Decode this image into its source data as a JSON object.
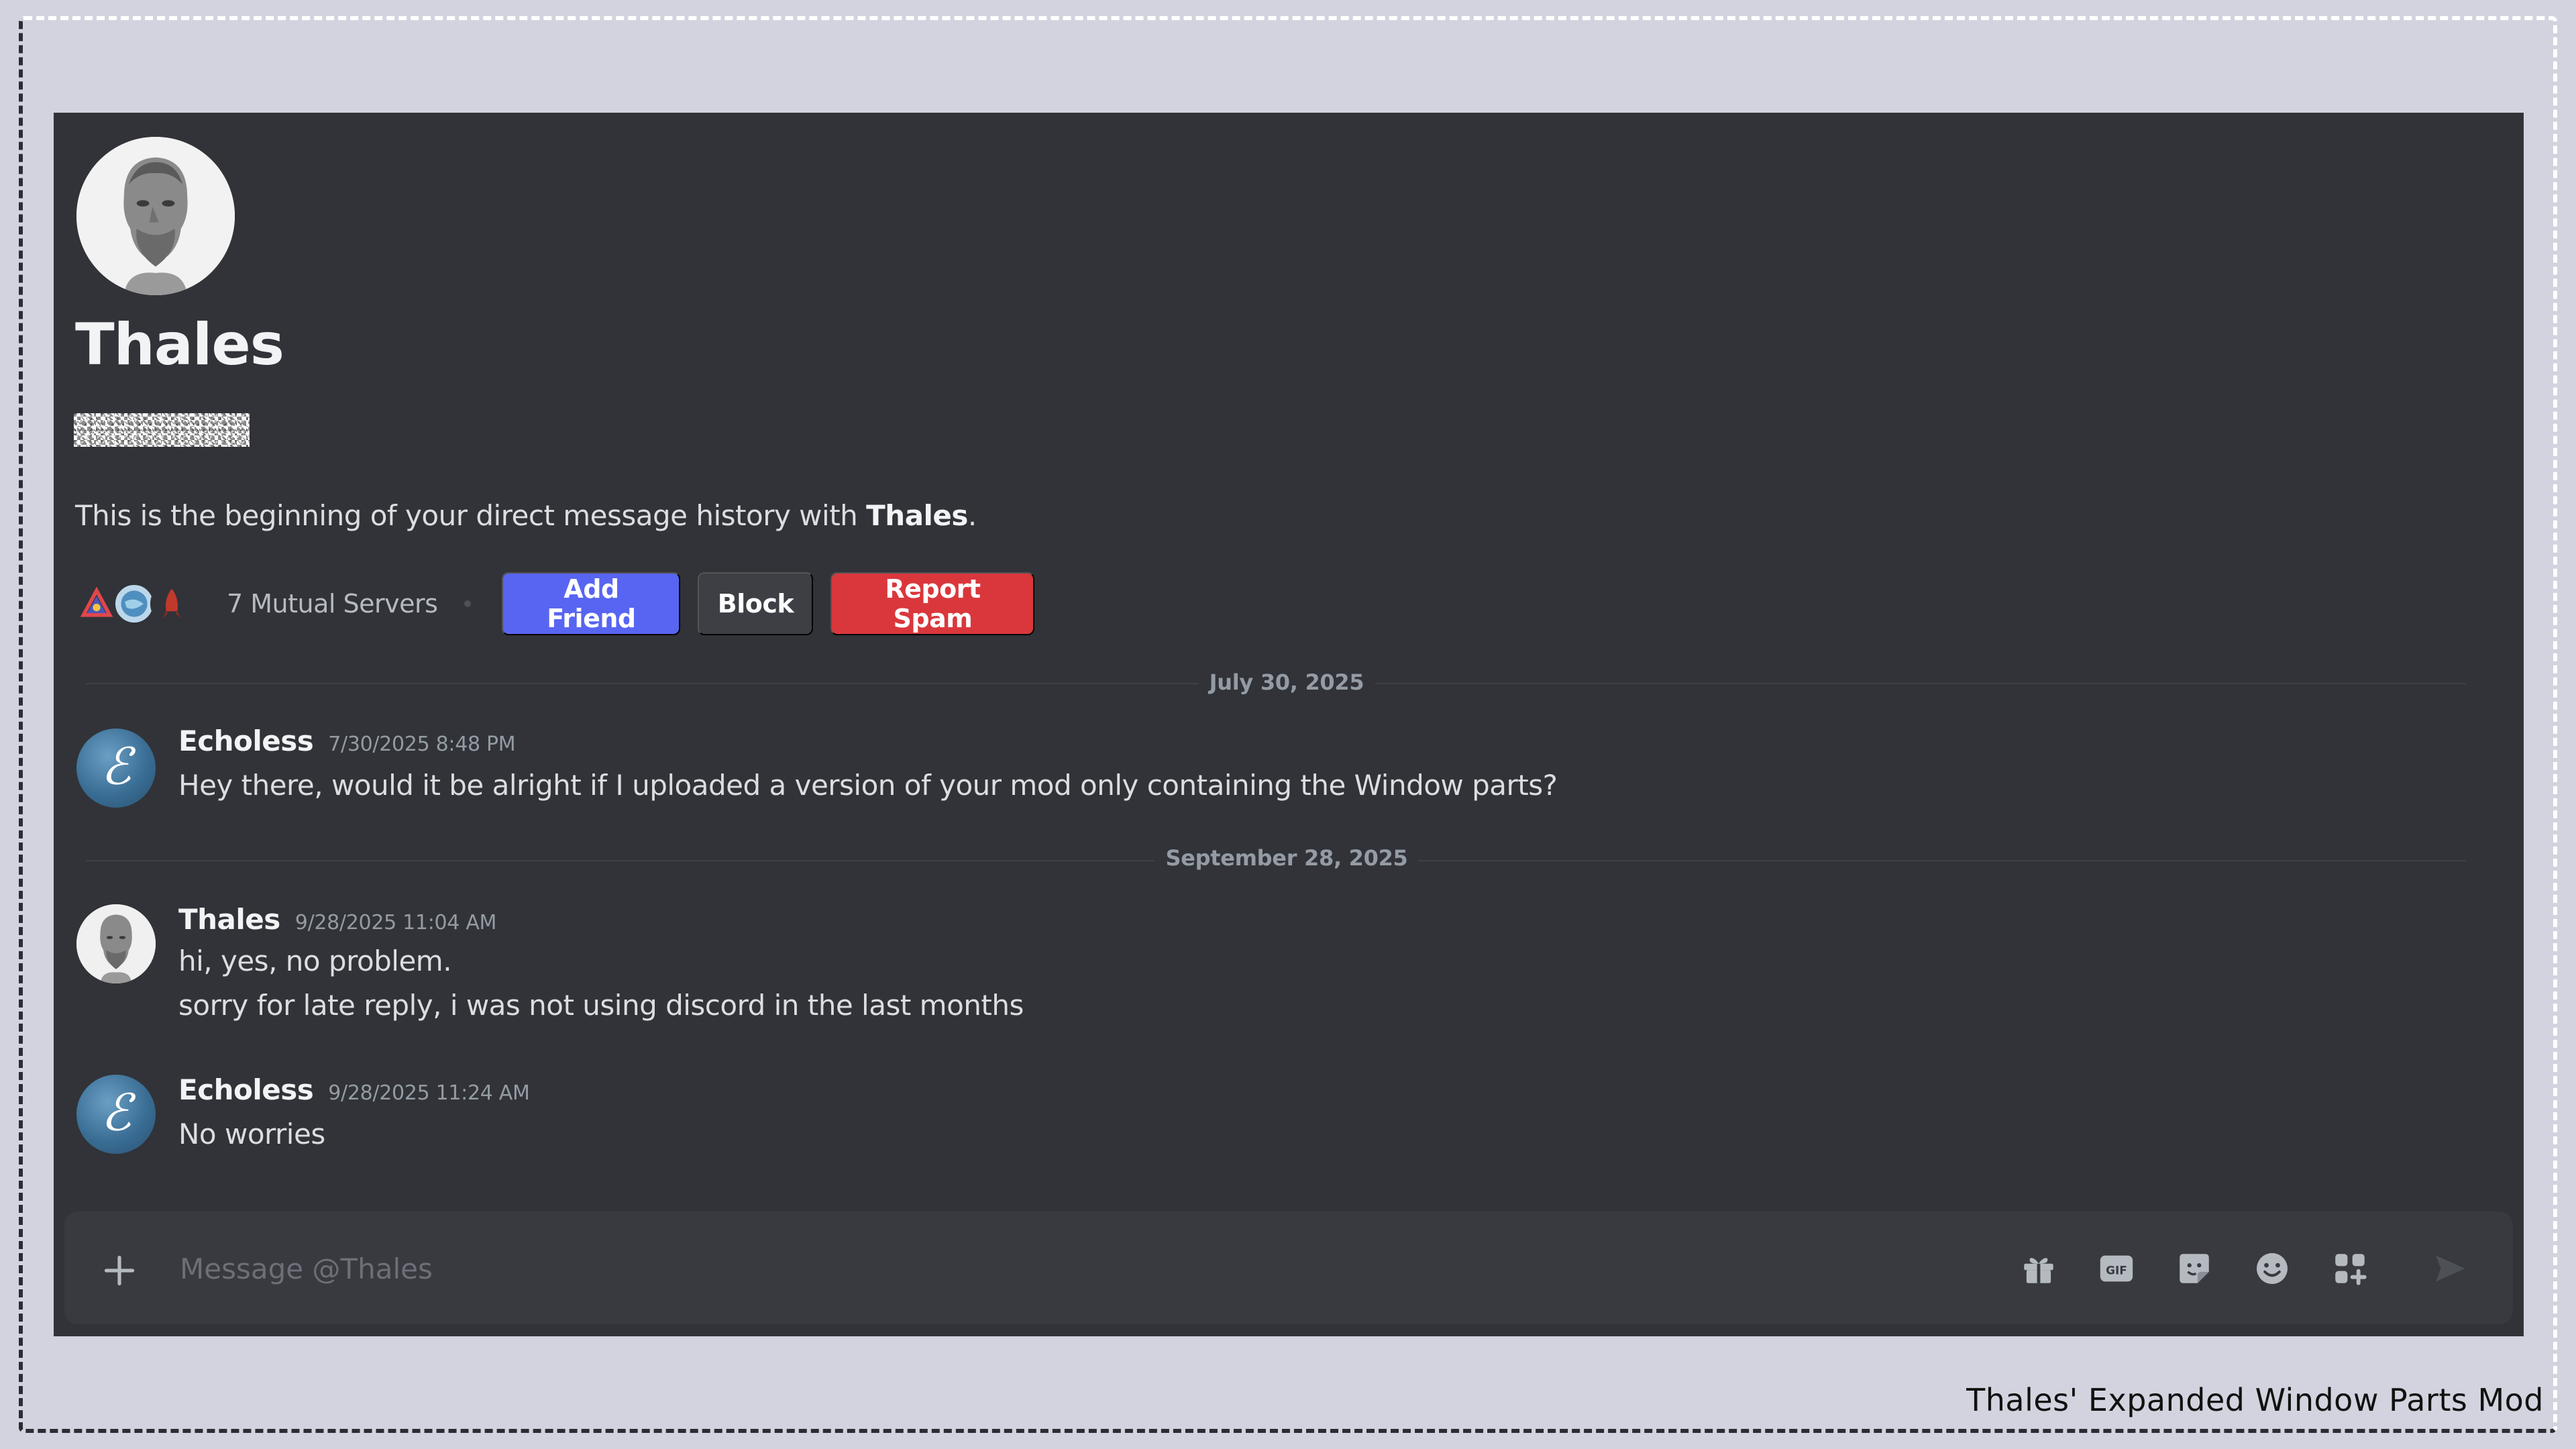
{
  "profile": {
    "name": "Thales",
    "intro_prefix": "This is the beginning of your direct message history with ",
    "intro_name": "Thales",
    "intro_suffix": "."
  },
  "actions": {
    "mutual_servers": "7 Mutual Servers",
    "add_friend": "Add Friend",
    "block": "Block",
    "report_spam": "Report Spam"
  },
  "dividers": [
    {
      "label": "July 30, 2025"
    },
    {
      "label": "September 28, 2025"
    }
  ],
  "messages": [
    {
      "author": "Echoless",
      "timestamp": "7/30/2025 8:48 PM",
      "lines": [
        "Hey there, would it be alright if I uploaded a version of your mod only containing the Window parts?"
      ]
    },
    {
      "author": "Thales",
      "timestamp": "9/28/2025 11:04 AM",
      "lines": [
        "hi, yes, no problem.",
        "sorry for late reply, i was not using discord in the last months"
      ]
    },
    {
      "author": "Echoless",
      "timestamp": "9/28/2025 11:24 AM",
      "lines": [
        "No worries"
      ]
    }
  ],
  "composer": {
    "placeholder": "Message @Thales",
    "icons": [
      "gift-icon",
      "gif-icon",
      "sticker-icon",
      "emoji-icon",
      "apps-icon",
      "send-icon"
    ]
  },
  "caption": "Thales' Expanded Window Parts Mod",
  "colors": {
    "background": "#d2d3de",
    "window": "#313338",
    "composer": "#383a40",
    "blurple": "#5865f2",
    "danger": "#da373c",
    "block_button": "#3d3f45"
  }
}
